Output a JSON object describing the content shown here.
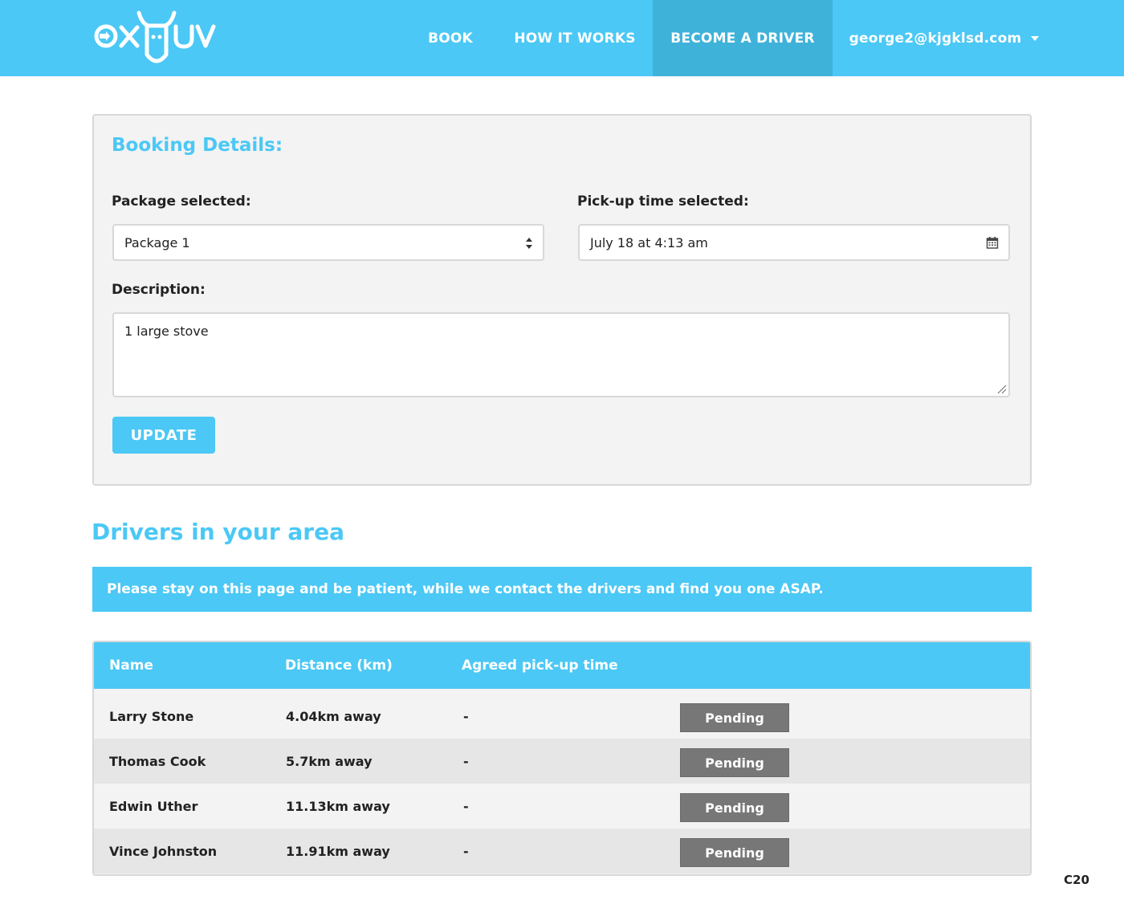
{
  "header": {
    "logo_text": "OXMUV",
    "nav": [
      {
        "label": "BOOK"
      },
      {
        "label": "HOW IT WORKS"
      },
      {
        "label": "BECOME A DRIVER"
      }
    ],
    "user_email": "george2@kjgklsd.com"
  },
  "booking": {
    "title": "Booking Details:",
    "package_label": "Package selected:",
    "package_value": "Package 1",
    "pickup_label": "Pick-up time selected:",
    "pickup_value": "July 18 at 4:13 am",
    "description_label": "Description:",
    "description_value": "1 large stove",
    "update_label": "UPDATE"
  },
  "drivers": {
    "title": "Drivers in your area",
    "notice": "Please stay on this page and be patient, while we contact the drivers and find you one ASAP.",
    "columns": [
      "Name",
      "Distance (km)",
      "Agreed pick-up time"
    ],
    "rows": [
      {
        "name": "Larry Stone",
        "distance": "4.04km away",
        "time": "-",
        "status": "Pending"
      },
      {
        "name": "Thomas Cook",
        "distance": "5.7km away",
        "time": "-",
        "status": "Pending"
      },
      {
        "name": "Edwin Uther",
        "distance": "11.13km away",
        "time": "-",
        "status": "Pending"
      },
      {
        "name": "Vince Johnston",
        "distance": "11.91km away",
        "time": "-",
        "status": "Pending"
      }
    ]
  },
  "corner_label": "C20",
  "colors": {
    "accent": "#4bc8f5",
    "active_nav": "#3fb2da",
    "status_badge": "#777777"
  }
}
